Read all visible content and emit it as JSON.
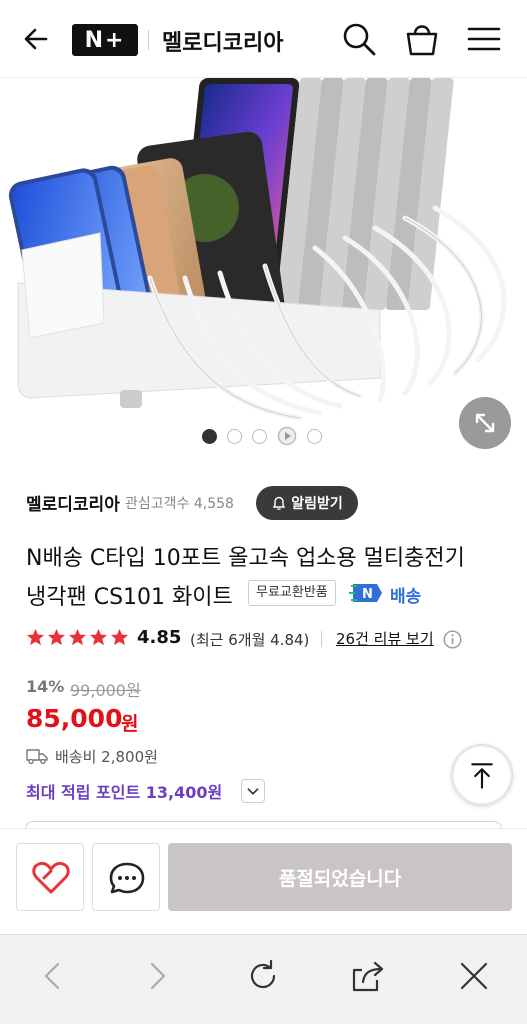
{
  "header": {
    "brand_badge": "N+",
    "store_name": "멜로디코리아"
  },
  "gallery": {
    "slide_count": 5,
    "active_index": 0
  },
  "seller": {
    "name": "멜로디코리아",
    "favorites": "관심고객수 4,558",
    "alarm_label": "알림받기"
  },
  "product": {
    "title_line1": "N배송 C타입 10포트 올고속 업소용 멀티충전기",
    "title_line2": "냉각팬 CS101 화이트",
    "return_badge": "무료교환반품",
    "n_badge": "N",
    "delivery_badge": "배송"
  },
  "rating": {
    "stars": 5,
    "score": "4.85",
    "recent": "(최근 6개월 4.84)",
    "reviews_link": "26건 리뷰 보기"
  },
  "price": {
    "discount": "14%",
    "original": "99,000원",
    "sale": "85,000",
    "currency": "원",
    "shipping": "배송비 2,800원",
    "points": "최대 적립 포인트 13,400원"
  },
  "actions": {
    "soldout_label": "품절되었습니다"
  },
  "colors": {
    "price_red": "#e0111a",
    "points_purple": "#6a3fbf",
    "delivery_blue": "#2f6fd8",
    "wish_red": "#e8323a"
  }
}
